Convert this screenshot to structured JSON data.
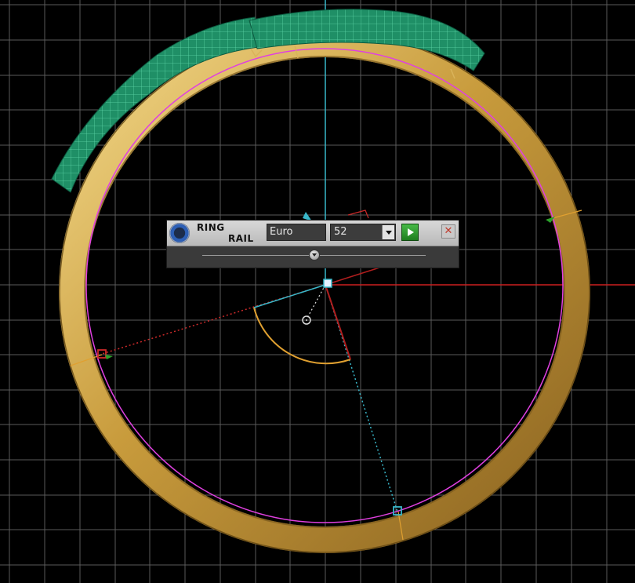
{
  "panel": {
    "title_line1": "RING",
    "title_line2": "RAIL",
    "standard": "Euro",
    "size": "52",
    "apply_icon": "play-icon",
    "close_label": "✕",
    "slider_level": 0.5
  },
  "colors": {
    "background": "#000000",
    "grid": "#5a5a5a",
    "ring_gold": "#c9a24a",
    "mesh_green": "#2a9a70",
    "axis_red": "#cc1f1f",
    "axis_cyan": "#39b7c9",
    "rail_magenta": "#e040e0",
    "accent_green": "#2aa02a"
  }
}
